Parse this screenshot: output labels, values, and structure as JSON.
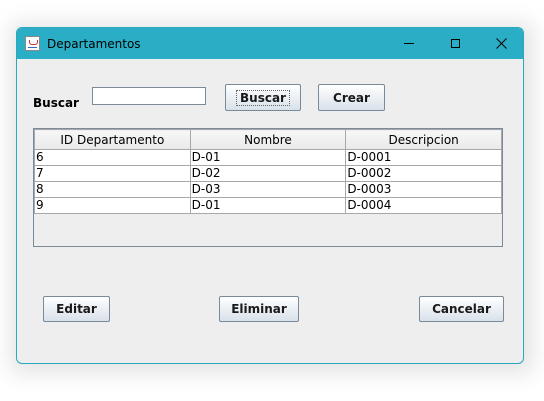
{
  "window": {
    "title": "Departamentos"
  },
  "search": {
    "label": "Buscar",
    "value": "",
    "button_label": "Buscar"
  },
  "create_button_label": "Crear",
  "table": {
    "headers": [
      "ID Departamento",
      "Nombre",
      "Descripcion"
    ],
    "rows": [
      [
        "6",
        "D-01",
        "D-0001"
      ],
      [
        "7",
        "D-02",
        "D-0002"
      ],
      [
        "8",
        "D-03",
        "D-0003"
      ],
      [
        "9",
        "D-01",
        "D-0004"
      ]
    ]
  },
  "bottom_buttons": {
    "edit": "Editar",
    "delete": "Eliminar",
    "cancel": "Cancelar"
  },
  "colors": {
    "titlebar": "#2aaec6",
    "window_bg": "#eeeeee"
  }
}
